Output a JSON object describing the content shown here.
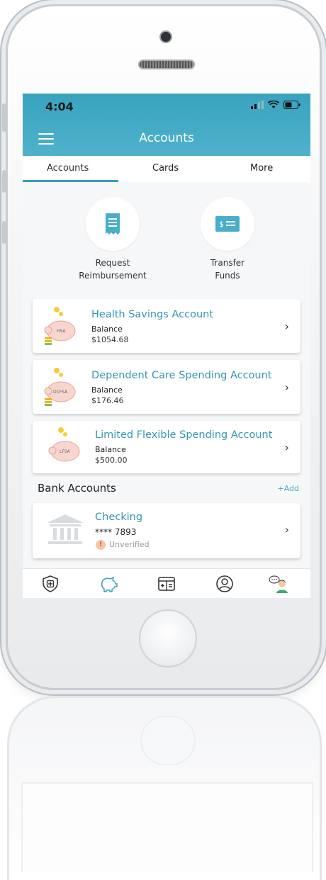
{
  "status_bar": {
    "time": "4:04"
  },
  "header": {
    "title": "Accounts"
  },
  "tabs": [
    {
      "label": "Accounts",
      "active": true
    },
    {
      "label": "Cards",
      "active": false
    },
    {
      "label": "More",
      "active": false
    }
  ],
  "actions": [
    {
      "label_line1": "Request",
      "label_line2": "Reimbursement",
      "icon": "receipt-icon"
    },
    {
      "label_line1": "Transfer",
      "label_line2": "Funds",
      "icon": "money-transfer-icon"
    }
  ],
  "accounts": [
    {
      "title": "Health Savings Account",
      "balance_label": "Balance",
      "balance": "$1054.68",
      "badge": "HSA"
    },
    {
      "title": "Dependent Care Spending Account",
      "balance_label": "Balance",
      "balance": "$176.46",
      "badge": "DCFSA"
    },
    {
      "title": "Limited Flexible Spending Account",
      "balance_label": "Balance",
      "balance": "$500.00",
      "badge": "LFSA"
    }
  ],
  "bank_section": {
    "title": "Bank Accounts",
    "add_label": "+Add",
    "account": {
      "name": "Checking",
      "number": "**** 7893",
      "status": "Unverified",
      "status_icon": "!"
    }
  },
  "colors": {
    "accent": "#3a9fba",
    "header": "#45aac5",
    "warning": "#f7a072"
  }
}
